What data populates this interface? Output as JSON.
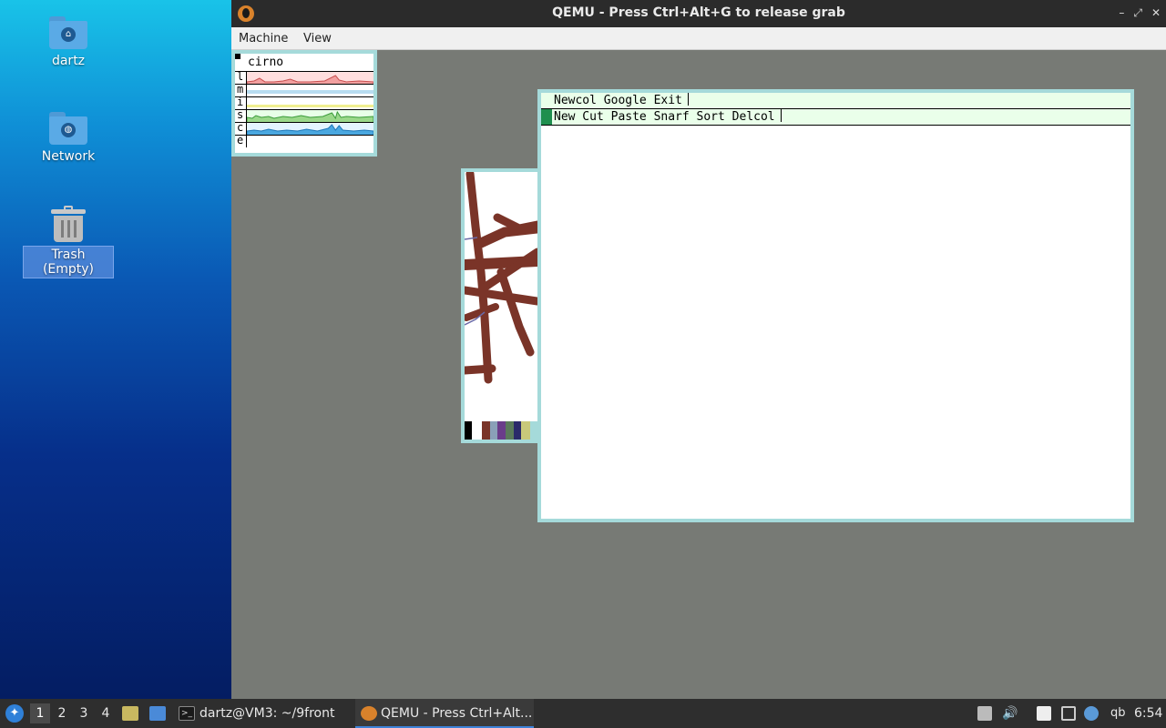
{
  "desktop": {
    "icons": [
      {
        "label": "dartz",
        "icon": "home-folder-icon"
      },
      {
        "label": "Network",
        "icon": "network-folder-icon"
      },
      {
        "label": "Trash (Empty)",
        "icon": "trash-icon"
      }
    ]
  },
  "window": {
    "title": "QEMU - Press Ctrl+Alt+G to release grab",
    "buttons": [
      "–",
      "⤢",
      "✕"
    ],
    "menu": [
      "Machine",
      "View"
    ]
  },
  "guest": {
    "stats": {
      "host": "cirno",
      "rows": [
        "l",
        "m",
        "i",
        "s",
        "c",
        "e"
      ]
    },
    "acme": {
      "column_tag": "Newcol Google Exit",
      "window_tag": "New Cut Paste Snarf Sort Delcol"
    }
  },
  "taskbar": {
    "workspaces": [
      "1",
      "2",
      "3",
      "4"
    ],
    "active_workspace": "1",
    "tasks": [
      {
        "label": "dartz@VM3: ~/9front",
        "icon": "terminal-icon"
      },
      {
        "label": "QEMU - Press Ctrl+Alt...",
        "icon": "qemu-icon"
      }
    ],
    "tray_text": "qb",
    "clock": "6:54"
  },
  "colors": {
    "acme_tag": "#eaffea",
    "acme_border": "#a5dada",
    "guest_bg": "#777a75",
    "paint_brush": "#7a3428"
  }
}
